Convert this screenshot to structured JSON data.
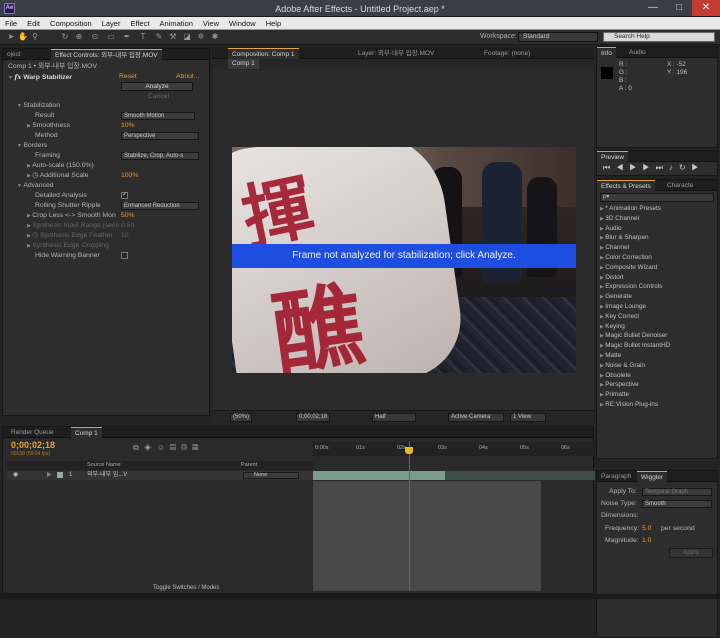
{
  "window": {
    "title": "Adobe After Effects - Untitled Project.aep *",
    "app_icon": "Ae",
    "minimize": "—",
    "maximize": "□",
    "close": "✕"
  },
  "menu": [
    "File",
    "Edit",
    "Composition",
    "Layer",
    "Effect",
    "Animation",
    "View",
    "Window",
    "Help"
  ],
  "toolbar": {
    "workspace_label": "Workspace:",
    "workspace_value": "Standard",
    "search_placeholder": "Search Help"
  },
  "effect_controls": {
    "tabs": [
      "oject",
      "Effect Controls: 외부-내부 입장.MOV"
    ],
    "layer_path": "Comp 1 • 외부-내부 입장.MOV",
    "effect_name": "Warp Stabilizer",
    "reset": "Reset",
    "about": "About...",
    "analyze": "Analyze",
    "cancel": "Cancel",
    "rows": [
      {
        "label": "Stabilization"
      },
      {
        "label": "Result",
        "value": "Smooth Motion"
      },
      {
        "label": "Smoothness",
        "value": "10%"
      },
      {
        "label": "Method",
        "value": "Perspective"
      },
      {
        "label": "Borders"
      },
      {
        "label": "Framing",
        "value": "Stabilize, Crop, Auto-s"
      },
      {
        "label": "Auto-scale (150.0%)"
      },
      {
        "label": "Additional Scale",
        "value": "100%"
      },
      {
        "label": "Advanced"
      },
      {
        "label": "Detailed Analysis"
      },
      {
        "label": "Rolling Shutter Ripple",
        "value": "Enhanced Reduction"
      },
      {
        "label": "Crop Less <-> Smooth Mon",
        "value": "50%"
      },
      {
        "label": "Synthesis Input Range (seco",
        "value": "0.50"
      },
      {
        "label": "Synthesis Edge Feather",
        "value": "10"
      },
      {
        "label": "Synthesis Edge Cropping"
      },
      {
        "label": "Hide Warning Banner"
      }
    ]
  },
  "composition": {
    "tabs": [
      "Composition: Comp 1",
      "Layer: 외부-내부 입장.MOV",
      "Footage: (none)"
    ],
    "comp_tab": "Comp 1",
    "banner": "Frame not analyzed for stabilization; click Analyze.",
    "footer": {
      "zoom": "(50%)",
      "timecode": "0;00;02;18",
      "resolution": "Half",
      "camera": "Active Camera",
      "views": "1 View"
    }
  },
  "info": {
    "tabs": [
      "Info",
      "Audio"
    ],
    "r": "R :",
    "g": "G :",
    "b": "B :",
    "a": "A : 0",
    "x": "X : -52",
    "y": "Y : 196"
  },
  "preview": {
    "tab": "Preview"
  },
  "effects_presets": {
    "tabs": [
      "Effects & Presets",
      "Characte"
    ],
    "search": "ρ▾",
    "items": [
      "* Animation Presets",
      "3D Channel",
      "Audio",
      "Blur & Sharpen",
      "Channel",
      "Color Correction",
      "Composite Wizard",
      "Distort",
      "Expression Controls",
      "Generate",
      "Image Lounge",
      "Key Correct",
      "Keying",
      "Magic Bullet Denoiser",
      "Magic Bullet InstantHD",
      "Matte",
      "Noise & Grain",
      "Obsolete",
      "Perspective",
      "Primatte",
      "RE:Vision Plug-ins"
    ]
  },
  "wiggler": {
    "tabs": [
      "Paragraph",
      "Wiggler"
    ],
    "apply_to_label": "Apply To:",
    "apply_to_value": "Temporal Graph",
    "noise_label": "Noise Type:",
    "noise_value": "Smooth",
    "dimensions_label": "Dimensions:",
    "frequency_label": "Frequency:",
    "frequency_value": "5.0",
    "frequency_unit": "per second",
    "magnitude_label": "Magnitude:",
    "magnitude_value": "1.0",
    "apply": "Apply"
  },
  "timeline": {
    "tabs": [
      "Render Queue",
      "Comp 1"
    ],
    "time": "0;00;02;18",
    "fps": "00138 (59.94 fps)",
    "col_source": "Source Name",
    "col_parent": "Parent",
    "layer_index": "1",
    "layer_name": "외부-내부 입...V",
    "layer_parent": "None",
    "ticks": [
      "0:00s",
      "01s",
      "02s",
      "03s",
      "04s",
      "05s",
      "06s"
    ],
    "toggle": "Toggle Switches / Modes"
  }
}
